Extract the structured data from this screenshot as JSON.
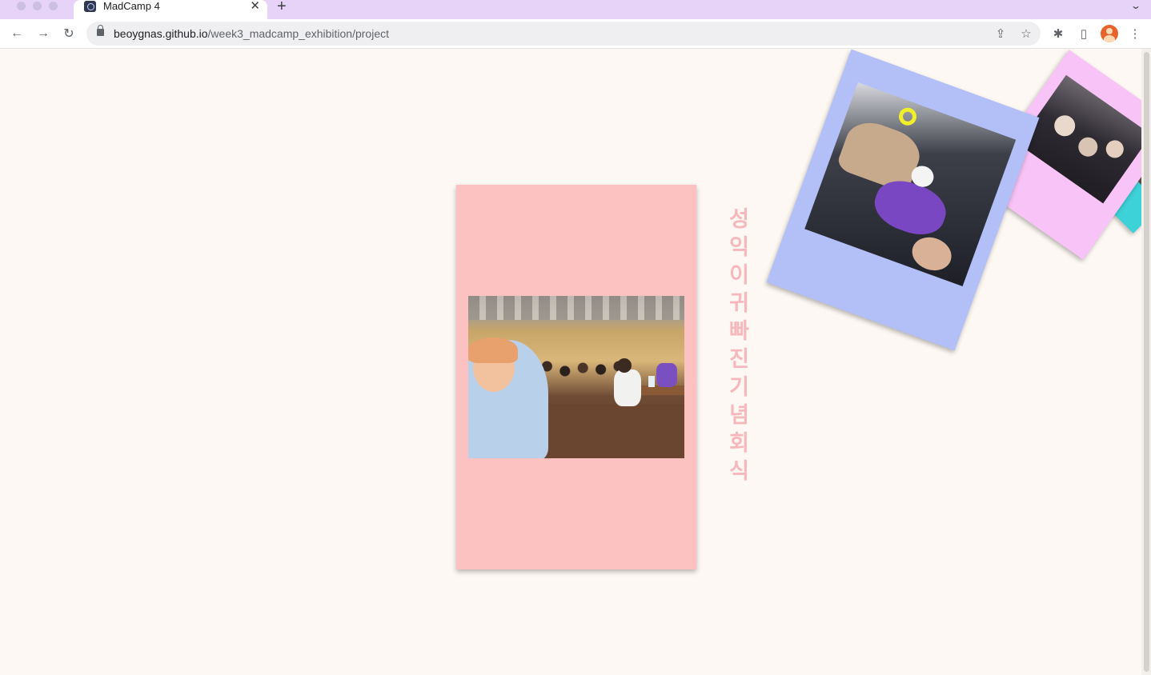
{
  "browser": {
    "tab": {
      "title": "MadCamp 4",
      "close_glyph": "✕",
      "favicon": "react-icon"
    },
    "new_tab_glyph": "+",
    "tab_menu_glyph": "⌄",
    "nav": {
      "back_glyph": "←",
      "forward_glyph": "→",
      "reload_glyph": "↻"
    },
    "url": {
      "domain": "beoygnas.github.io",
      "path": "/week3_madcamp_exhibition/project"
    },
    "icons": {
      "share": "⇪",
      "star": "☆",
      "extensions": "✱",
      "sidepanel": "▯",
      "menu": "⋮"
    }
  },
  "page": {
    "vertical_title": "성익이귀빠진기념회식",
    "cards": [
      {
        "name": "main-card",
        "color": "#fcc1c1",
        "photo": "group-dinner-photo"
      },
      {
        "name": "blue-card",
        "color": "#b2c0f7",
        "photo": "friends-photo"
      },
      {
        "name": "pink-card",
        "color": "#f8c3f7",
        "photo": "selfie-photo"
      },
      {
        "name": "teal-card",
        "color": "#3dd1d8",
        "photo": "room-photo"
      }
    ]
  },
  "colors": {
    "tab_strip": "#e6d3f7",
    "page_background": "#fdf8f3",
    "title_pink": "#f7b8bd"
  }
}
